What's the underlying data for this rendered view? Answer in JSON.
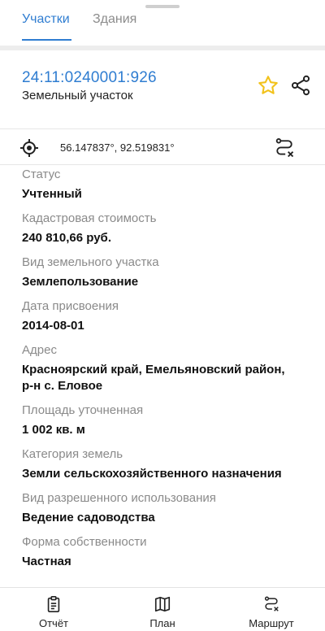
{
  "tabs": {
    "plots": "Участки",
    "buildings": "Здания"
  },
  "object": {
    "cadastral_number": "24:11:0240001:926",
    "type": "Земельный участок"
  },
  "coordinates": "56.147837°, 92.519831°",
  "fields": [
    {
      "label": "Статус",
      "value": "Учтенный"
    },
    {
      "label": "Кадастровая стоимость",
      "value": "240 810,66 руб."
    },
    {
      "label": "Вид земельного участка",
      "value": "Землепользование"
    },
    {
      "label": "Дата присвоения",
      "value": "2014-08-01"
    },
    {
      "label": "Адрес",
      "value_line1": "Красноярский край, Емельяновский район,",
      "value_line2": "р-н с. Еловое"
    },
    {
      "label": "Площадь уточненная",
      "value": "1 002 кв. м"
    },
    {
      "label": "Категория земель",
      "value": "Земли сельскохозяйственного назначения"
    },
    {
      "label": "Вид разрешенного использования",
      "value": "Ведение садоводства"
    },
    {
      "label": "Форма собственности",
      "value": "Частная"
    }
  ],
  "bottom_nav": {
    "report": "Отчёт",
    "map": "План",
    "route": "Маршрут"
  },
  "icons": {
    "favorite": "star-icon",
    "share": "share-icon",
    "location": "crosshair-icon",
    "route": "route-icon",
    "report": "clipboard-icon",
    "map": "map-icon"
  },
  "colors": {
    "accent": "#2f7dd1",
    "star": "#f2c21b"
  }
}
